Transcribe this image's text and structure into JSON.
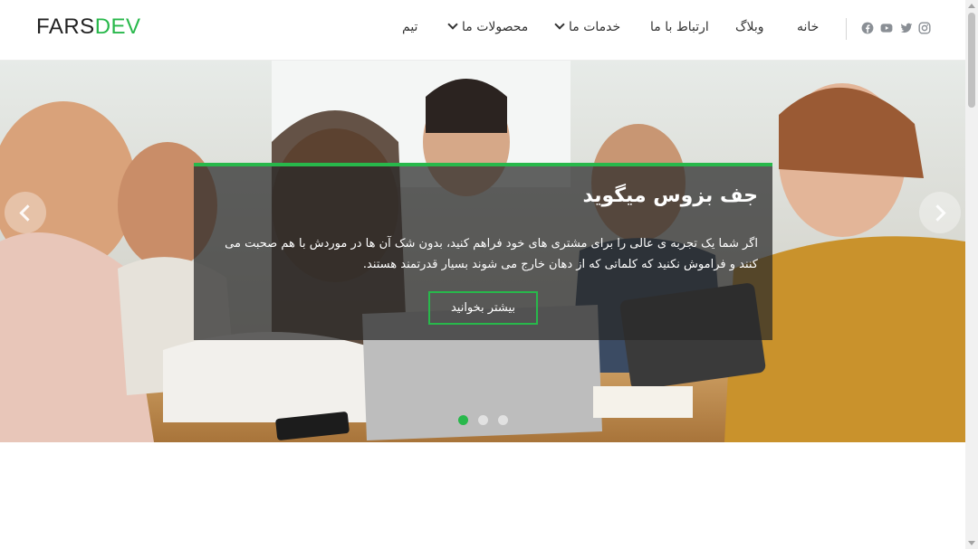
{
  "header": {
    "logo_primary": "FARS",
    "logo_accent": "DEV",
    "accent_color": "#28b84b",
    "social_icons": [
      "instagram-icon",
      "twitter-icon",
      "youtube-icon",
      "facebook-icon"
    ],
    "nav": [
      {
        "label": "خانه",
        "has_dropdown": false
      },
      {
        "label": "وبلاگ",
        "has_dropdown": false
      },
      {
        "label": "ارتباط با ما",
        "has_dropdown": false
      },
      {
        "label": "خدمات ما",
        "has_dropdown": true
      },
      {
        "label": "محصولات ما",
        "has_dropdown": true
      },
      {
        "label": "تیم",
        "has_dropdown": false
      }
    ]
  },
  "hero": {
    "title": "جف بزوس میگوید",
    "text": "اگر شما یک تجربه ی عالی را برای مشتری های خود فراهم کنید، بدون شک آن ها در موردش با هم صحبت می کنند و فراموش نکنید که کلماتی که از دهان خارج می شوند بسیار قدرتمند هستند.",
    "button_label": "بیشتر بخوانید",
    "slides_total": 3,
    "active_slide": 1
  }
}
